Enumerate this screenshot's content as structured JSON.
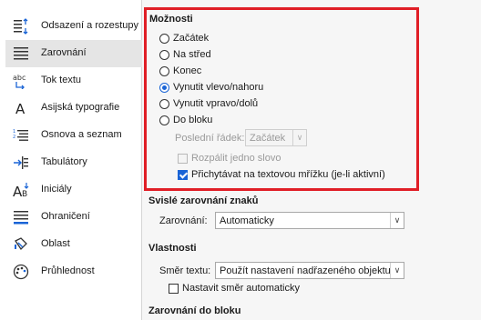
{
  "sidebar": {
    "items": [
      {
        "label": "Odsazení a rozestupy",
        "icon": "indent-spacing-icon"
      },
      {
        "label": "Zarovnání",
        "icon": "align-justify-icon"
      },
      {
        "label": "Tok textu",
        "icon": "text-flow-icon"
      },
      {
        "label": "Asijská typografie",
        "icon": "asian-typography-icon"
      },
      {
        "label": "Osnova a seznam",
        "icon": "outline-list-icon"
      },
      {
        "label": "Tabulátory",
        "icon": "tabs-icon"
      },
      {
        "label": "Iniciály",
        "icon": "drop-caps-icon"
      },
      {
        "label": "Ohraničení",
        "icon": "borders-icon"
      },
      {
        "label": "Oblast",
        "icon": "area-fill-icon"
      },
      {
        "label": "Průhlednost",
        "icon": "transparency-icon"
      }
    ],
    "active_index": 1
  },
  "options": {
    "title": "Možnosti",
    "radios": [
      {
        "label": "Začátek",
        "checked": false
      },
      {
        "label": "Na střed",
        "checked": false
      },
      {
        "label": "Konec",
        "checked": false
      },
      {
        "label": "Vynutit vlevo/nahoru",
        "checked": true
      },
      {
        "label": "Vynutit vpravo/dolů",
        "checked": false
      },
      {
        "label": "Do bloku",
        "checked": false
      }
    ],
    "last_line_label": "Poslední řádek:",
    "last_line_value": "Začátek",
    "expand_single_word": "Rozpálit jedno slovo",
    "snap_to_grid": "Přichytávat na textovou mřížku (je-li aktivní)"
  },
  "vertical": {
    "title": "Svislé zarovnání znaků",
    "align_label": "Zarovnání:",
    "align_value": "Automaticky"
  },
  "properties": {
    "title": "Vlastnosti",
    "direction_label": "Směr textu:",
    "direction_value": "Použít nastavení nadřazeného objektu",
    "auto_direction": "Nastavit směr automaticky"
  },
  "block": {
    "title": "Zarovnání do bloku"
  },
  "colors": {
    "accent": "#1a64d6",
    "highlight_border": "#e01e26"
  }
}
